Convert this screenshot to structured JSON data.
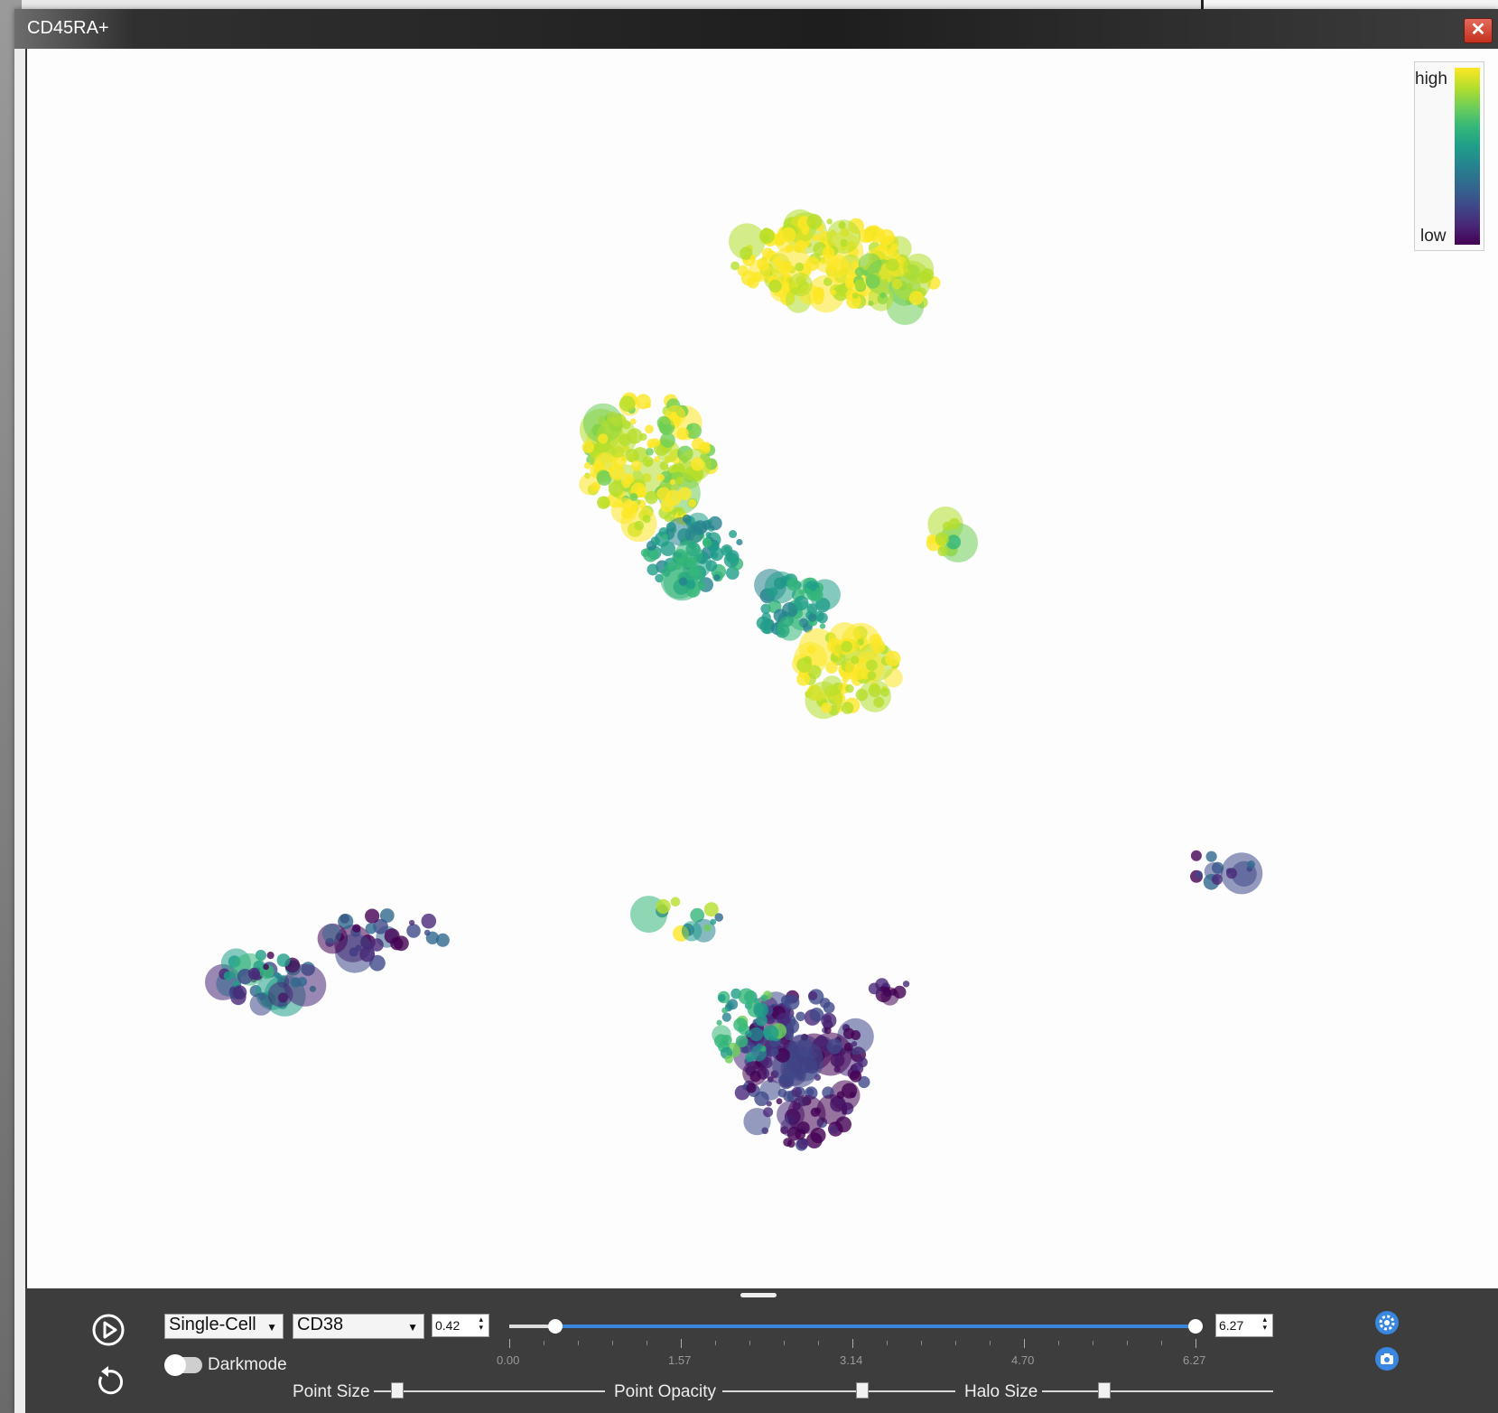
{
  "window": {
    "title": "CD45RA+"
  },
  "legend": {
    "high_label": "high",
    "low_label": "low",
    "colors": [
      "#fde725",
      "#35b779",
      "#31688e",
      "#440154"
    ]
  },
  "controls": {
    "mode_select": "Single-Cell",
    "marker_select": "CD38",
    "range_min": "0.42",
    "range_max": "6.27",
    "range_slider": {
      "min": 0.0,
      "max": 6.27,
      "low": 0.42,
      "high": 6.27
    },
    "ticks": [
      "0.00",
      "1.57",
      "3.14",
      "4.70",
      "6.27"
    ],
    "darkmode_label": "Darkmode",
    "darkmode_on": false,
    "point_size_label": "Point Size",
    "point_size_level": 0.1,
    "point_opacity_label": "Point Opacity",
    "point_opacity_level": 0.6,
    "halo_size_label": "Halo Size",
    "halo_size_level": 0.27,
    "accent_color": "#3a87e0"
  },
  "icons": [
    "play-icon",
    "reset-icon",
    "settings-gear-icon",
    "camera-icon",
    "close-icon"
  ]
}
